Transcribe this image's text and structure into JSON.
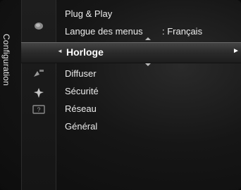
{
  "sidebar": {
    "title": "Configuration"
  },
  "menu": {
    "items": [
      {
        "label": "Plug & Play"
      },
      {
        "label": "Langue des menus",
        "value": ": Français"
      },
      {
        "label": "Horloge",
        "selected": true
      },
      {
        "label": "Diffuser"
      },
      {
        "label": "Sécurité"
      },
      {
        "label": "Réseau"
      },
      {
        "label": "Général"
      }
    ]
  },
  "icons": [
    "picture-icon",
    "setup-gear-icon",
    "satellite-icon",
    "security-icon",
    "help-icon"
  ],
  "colors": {
    "background": "#161616",
    "text": "#ececec",
    "highlight": "#444444"
  }
}
